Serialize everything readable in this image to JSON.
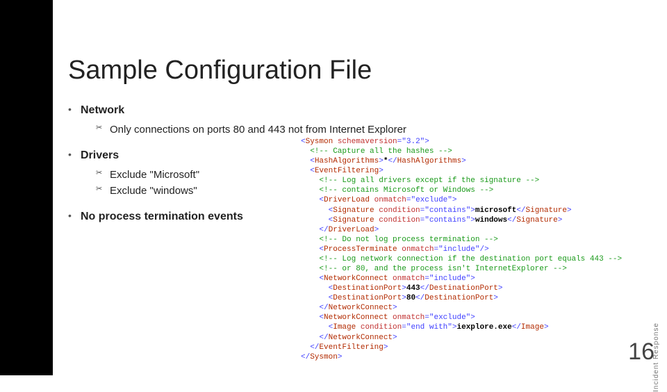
{
  "title": "Sample Configuration File",
  "bullets": {
    "network": {
      "head": "Network",
      "sub": [
        "Only connections on ports 80 and 443 not from Internet Explorer"
      ]
    },
    "drivers": {
      "head": "Drivers",
      "sub": [
        "Exclude \"Microsoft\"",
        "Exclude \"windows\""
      ]
    },
    "noproc": {
      "head": "No process termination events"
    }
  },
  "code": {
    "l01a": "Sysmon",
    "l01b": "schemaversion",
    "l01c": "\"3.2\"",
    "l02": "<!-- Capture all the hashes -->",
    "l03a": "HashAlgorithms",
    "l03b": "*",
    "l03c": "HashAlgorithms",
    "l04a": "EventFiltering",
    "l05": "<!-- Log all drivers except if the signature -->",
    "l06": "<!-- contains Microsoft or Windows -->",
    "l07a": "DriverLoad",
    "l07b": "onmatch",
    "l07c": "\"exclude\"",
    "l08a": "Signature",
    "l08b": "condition",
    "l08c": "\"contains\"",
    "l08d": "microsoft",
    "l08e": "Signature",
    "l09a": "Signature",
    "l09b": "condition",
    "l09c": "\"contains\"",
    "l09d": "windows",
    "l09e": "Signature",
    "l10a": "DriverLoad",
    "l11": "<!-- Do not log process termination -->",
    "l12a": "ProcessTerminate",
    "l12b": "onmatch",
    "l12c": "\"include\"",
    "l13": "<!-- Log network connection if the destination port equals 443 -->",
    "l14": "<!-- or 80, and the process isn't InternetExplorer -->",
    "l15a": "NetworkConnect",
    "l15b": "onmatch",
    "l15c": "\"include\"",
    "l16a": "DestinationPort",
    "l16b": "443",
    "l16c": "DestinationPort",
    "l17a": "DestinationPort",
    "l17b": "80",
    "l17c": "DestinationPort",
    "l18a": "NetworkConnect",
    "l19a": "NetworkConnect",
    "l19b": "onmatch",
    "l19c": "\"exclude\"",
    "l20a": "Image",
    "l20b": "condition",
    "l20c": "\"end with\"",
    "l20d": "iexplore.exe",
    "l20e": "Image",
    "l21a": "NetworkConnect",
    "l22a": "EventFiltering",
    "l23a": "Sysmon"
  },
  "footer": "Incident Response",
  "page": "16"
}
